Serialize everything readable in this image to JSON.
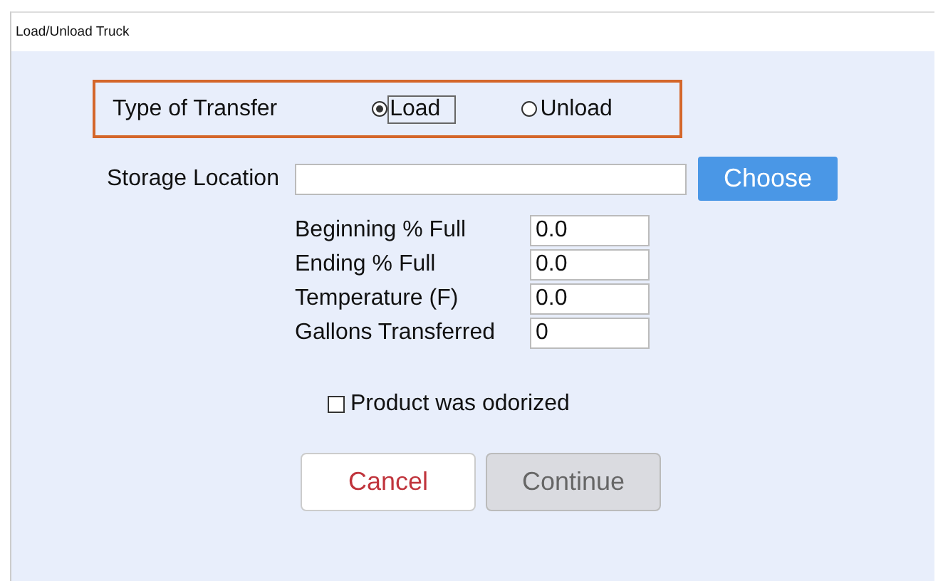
{
  "window": {
    "title": "Load/Unload Truck"
  },
  "transfer": {
    "label": "Type of Transfer",
    "options": [
      {
        "label": "Load",
        "selected": true,
        "focused": true
      },
      {
        "label": "Unload",
        "selected": false,
        "focused": false
      }
    ]
  },
  "storage": {
    "label": "Storage Location",
    "button": "Choose"
  },
  "fields": [
    {
      "label": "Beginning % Full",
      "value": "0.0"
    },
    {
      "label": "Ending % Full",
      "value": "0.0"
    },
    {
      "label": "Temperature (F)",
      "value": "0.0"
    },
    {
      "label": "Gallons Transferred",
      "value": "0"
    }
  ],
  "odorized": {
    "label": "Product was odorized",
    "checked": false
  },
  "buttons": [
    {
      "label": "Cancel",
      "disabled": false
    },
    {
      "label": "Continue",
      "disabled": true
    }
  ]
}
